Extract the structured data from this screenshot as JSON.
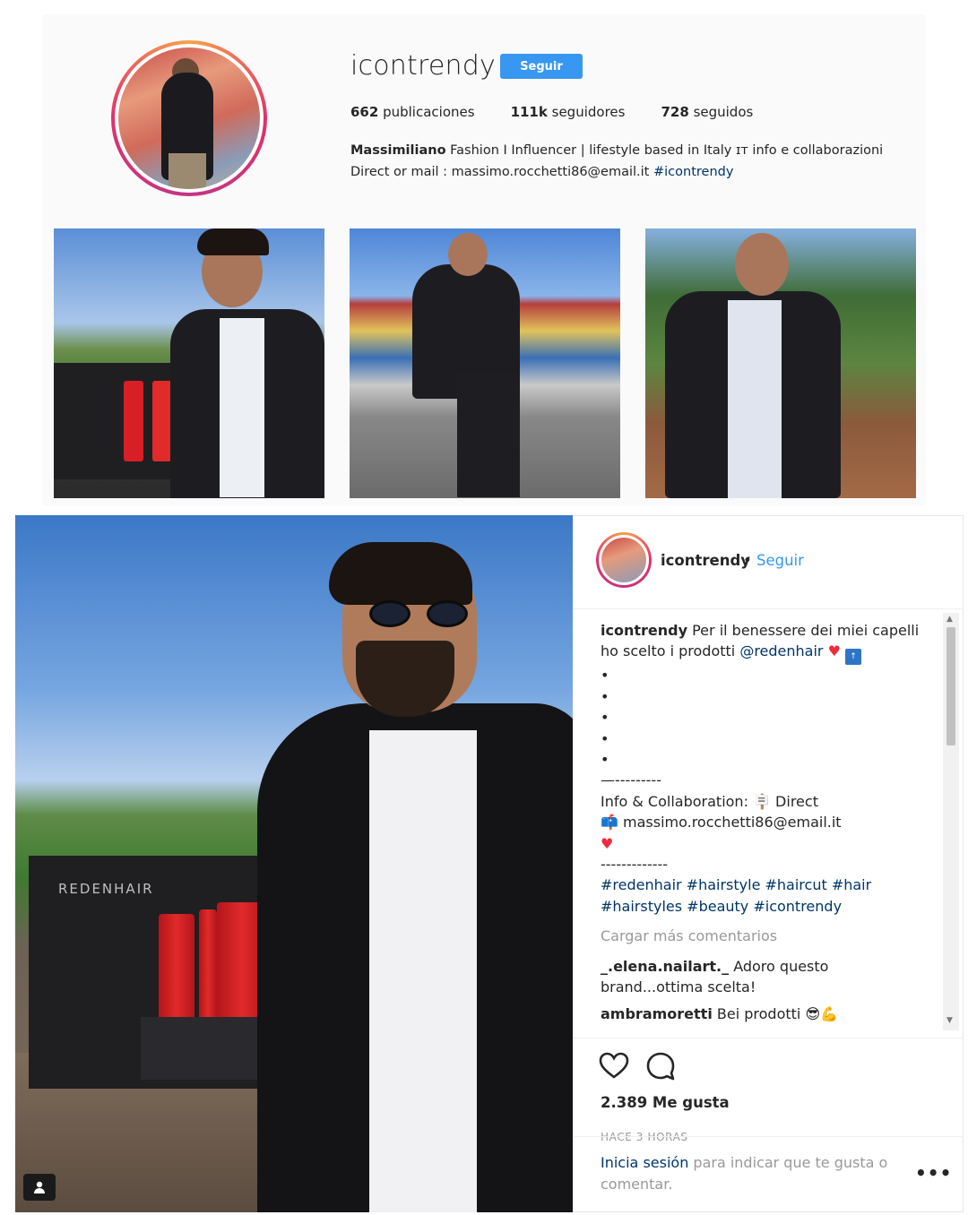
{
  "profile": {
    "username": "icontrendy",
    "follow_label": "Seguir",
    "stats": [
      {
        "value": "662",
        "label": "publicaciones"
      },
      {
        "value": "111k",
        "label": "seguidores"
      },
      {
        "value": "728",
        "label": "seguidos"
      }
    ],
    "bio_name": "Massimiliano",
    "bio_text": " Fashion I Influencer | lifestyle based in Italy ɪᴛ info e collaborazioni Direct or mail : massimo.rocchetti86@email.it ",
    "bio_hashtag": "#icontrendy"
  },
  "grid": {
    "thumbnails": [
      {
        "name": "thumb-1"
      },
      {
        "name": "thumb-2"
      },
      {
        "name": "thumb-3"
      }
    ]
  },
  "post": {
    "product_brand": "REDENHAIR",
    "header": {
      "username": "icontrendy",
      "dot": "•",
      "follow_label": "Seguir"
    },
    "caption": {
      "username": "icontrendy",
      "text": " Per il benessere dei miei capelli ho scelto i prodotti ",
      "mention": "@redenhair",
      "dots": [
        "•",
        "•",
        "•",
        "•",
        "•"
      ],
      "divider": "—---------",
      "info_label": "Info & Collaboration: ",
      "info_direct": " Direct",
      "email": " massimo.rocchetti86@email.it",
      "divider2": "-------------",
      "hashtags": "#redenhair #hairstyle #haircut #hair #hairstyles #beauty #icontrendy"
    },
    "load_more": "Cargar más comentarios",
    "comments": [
      {
        "username": "_.elena.nailart._",
        "text": " Adoro questo brand...ottima scelta!"
      },
      {
        "username": "ambramoretti",
        "text": " Bei prodotti "
      }
    ],
    "likes": "2.389 Me gusta",
    "timestamp": "HACE 3 HORAS",
    "login_link": "Inicia sesión",
    "login_text": " para indicar que te gusta o comentar.",
    "more": "•••"
  },
  "colors": {
    "accent": "#3897f0",
    "link": "#003569",
    "muted": "#999999",
    "panel": "#fafafa"
  }
}
